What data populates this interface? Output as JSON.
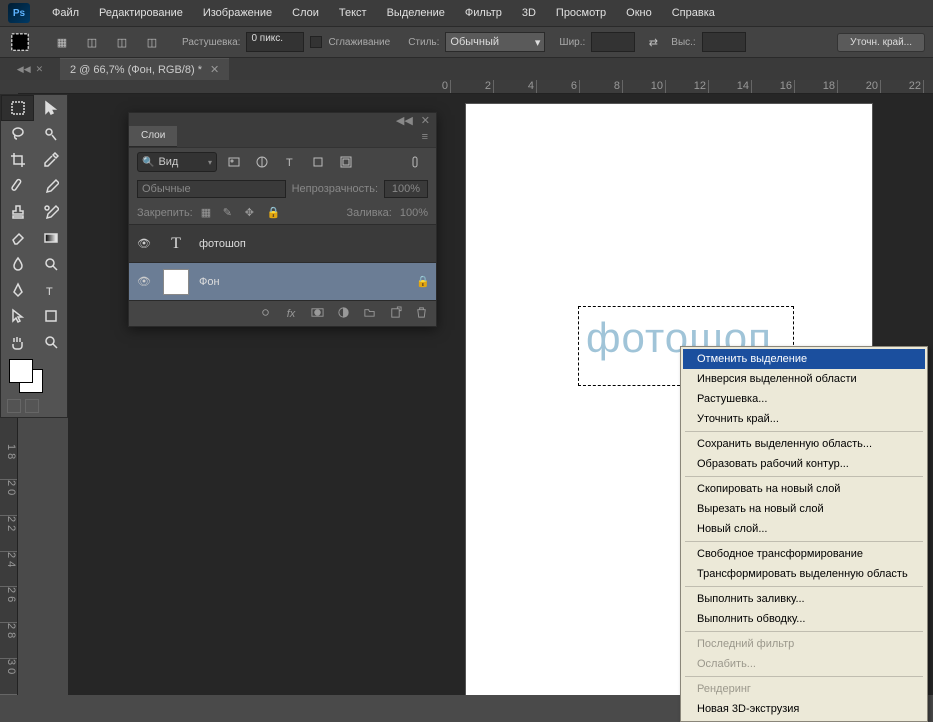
{
  "menu": [
    "Файл",
    "Редактирование",
    "Изображение",
    "Слои",
    "Текст",
    "Выделение",
    "Фильтр",
    "3D",
    "Просмотр",
    "Окно",
    "Справка"
  ],
  "options": {
    "feather_label": "Растушевка:",
    "feather_value": "0 пикс.",
    "antialias": "Сглаживание",
    "style_label": "Стиль:",
    "style_value": "Обычный",
    "w_label": "Шир.:",
    "h_label": "Выс.:",
    "refine": "Уточн. край..."
  },
  "doc_tab": "2 @ 66,7% (Фон, RGB/8) *",
  "ruler_h": [
    "0",
    "2",
    "4",
    "6",
    "8",
    "10",
    "12",
    "14",
    "16",
    "18",
    "20",
    "22"
  ],
  "ruler_v": [
    "1 8",
    "2 0",
    "2 2",
    "2 4",
    "2 6",
    "2 8",
    "3 0"
  ],
  "canvas_text": "фотошоп",
  "layers_panel": {
    "title": "Слои",
    "search": "Вид",
    "blend": "Обычные",
    "opacity_label": "Непрозрачность:",
    "opacity": "100%",
    "lock_label": "Закрепить:",
    "fill_label": "Заливка:",
    "fill": "100%",
    "layers": [
      {
        "name": "фотошоп",
        "type": "T"
      },
      {
        "name": "Фон",
        "type": "bg",
        "locked": true
      }
    ]
  },
  "context": [
    {
      "t": "Отменить выделение",
      "k": "hi"
    },
    {
      "t": "Инверсия выделенной области"
    },
    {
      "t": "Растушевка..."
    },
    {
      "t": "Уточнить край..."
    },
    {
      "sep": true
    },
    {
      "t": "Сохранить выделенную область..."
    },
    {
      "t": "Образовать рабочий контур..."
    },
    {
      "sep": true
    },
    {
      "t": "Скопировать на новый слой"
    },
    {
      "t": "Вырезать на новый слой"
    },
    {
      "t": "Новый слой..."
    },
    {
      "sep": true
    },
    {
      "t": "Свободное трансформирование"
    },
    {
      "t": "Трансформировать выделенную область"
    },
    {
      "sep": true
    },
    {
      "t": "Выполнить заливку..."
    },
    {
      "t": "Выполнить обводку..."
    },
    {
      "sep": true
    },
    {
      "t": "Последний фильтр",
      "k": "dis"
    },
    {
      "t": "Ослабить...",
      "k": "dis"
    },
    {
      "sep": true
    },
    {
      "t": "Рендеринг",
      "k": "dis"
    },
    {
      "t": "Новая 3D-экструзия"
    }
  ]
}
